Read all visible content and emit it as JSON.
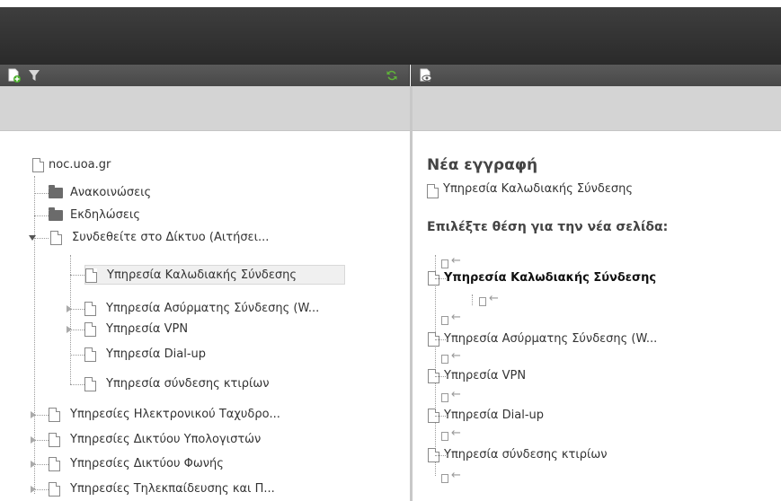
{
  "tree": {
    "root": "noc.uoa.gr",
    "items": [
      {
        "label": "Ανακοινώσεις"
      },
      {
        "label": "Εκδηλώσεις"
      },
      {
        "label": "Συνδεθείτε στο Δίκτυο (Αιτήσει..."
      },
      {
        "label": "Υπηρεσία Καλωδιακής Σύνδεσης"
      },
      {
        "label": "Υπηρεσία Ασύρματης Σύνδεσης (W..."
      },
      {
        "label": "Υπηρεσία VPN"
      },
      {
        "label": "Υπηρεσία Dial-up"
      },
      {
        "label": "Υπηρεσία σύνδεσης κτιρίων"
      },
      {
        "label": "Υπηρεσίες Ηλεκτρονικού Ταχυδρο..."
      },
      {
        "label": "Υπηρεσίες Δικτύου Υπολογιστών"
      },
      {
        "label": "Υπηρεσίες Δικτύου Φωνής"
      },
      {
        "label": "Υπηρεσίες Τηλεκπαίδευσης και Π..."
      }
    ]
  },
  "right_panel": {
    "title": "Νέα εγγραφή",
    "new_page": "Υπηρεσία Καλωδιακής Σύνδεσης",
    "heading": "Επιλέξτε θέση για την νέα σελίδα:",
    "pages": [
      {
        "label": "Υπηρεσία Καλωδιακής Σύνδεσης"
      },
      {
        "label": "Υπηρεσία Ασύρματης Σύνδεσης (W..."
      },
      {
        "label": "Υπηρεσία VPN"
      },
      {
        "label": "Υπηρεσία Dial-up"
      },
      {
        "label": "Υπηρεσία σύνδεσης κτιρίων"
      }
    ]
  },
  "icons": {
    "new_page": "new-page-icon",
    "filter": "filter-icon",
    "refresh": "refresh-icon",
    "view": "view-page-icon"
  },
  "colors": {
    "refresh": "#5fb33a",
    "new_page_badge": "#4caf2d"
  }
}
